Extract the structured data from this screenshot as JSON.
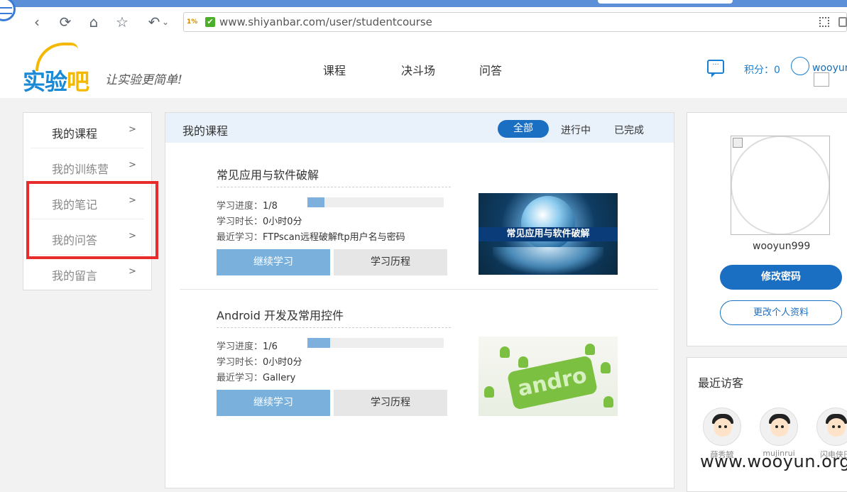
{
  "browser": {
    "url": "www.shiyanbar.com/user/studentcourse",
    "back_label": "‹",
    "refresh_label": "⟳",
    "home_label": "⌂",
    "star_label": "☆",
    "undo_label": "↶",
    "undo_menu_label": "⌄",
    "site_badge": "1%",
    "secure_check": "✔"
  },
  "header": {
    "logo_main": "实验",
    "logo_accent": "吧",
    "slogan": "让实验更简单!",
    "nav": [
      "课程",
      "决斗场",
      "问答"
    ],
    "points_label": "积分：0",
    "username": "wooyun",
    "msg_icon_glyph": "···"
  },
  "sidebar": {
    "items": [
      {
        "label": "我的课程",
        "arrow": ">"
      },
      {
        "label": "我的训练营",
        "arrow": ">"
      },
      {
        "label": "我的笔记",
        "arrow": ">"
      },
      {
        "label": "我的问答",
        "arrow": ">"
      },
      {
        "label": "我的留言",
        "arrow": ">"
      }
    ]
  },
  "main": {
    "title": "我的课程",
    "filters": [
      "全部",
      "进行中",
      "已完成"
    ],
    "labels": {
      "progress": "学习进度：",
      "duration": "学习时长：",
      "recent": "最近学习：",
      "continue": "继续学习",
      "history": "学习历程"
    },
    "courses": [
      {
        "title": "常见应用与软件破解",
        "progress": "1/8",
        "progress_fraction": 0.125,
        "duration": "0小时0分",
        "recent": "FTPscan远程破解ftp用户名与密码",
        "thumb_text": "常见应用与软件破解"
      },
      {
        "title": "Android 开发及常用控件",
        "progress": "1/6",
        "progress_fraction": 0.167,
        "duration": "0小时0分",
        "recent": "Gallery",
        "thumb_text": "andro"
      }
    ]
  },
  "profile": {
    "name": "wooyun999",
    "change_password": "修改密码",
    "edit_profile": "更改个人资料"
  },
  "visitors": {
    "title": "最近访客",
    "list": [
      "薛秀毓",
      "mujinrui",
      "闪电侠巴"
    ]
  },
  "watermark": "www.wooyun.org",
  "colors": {
    "brand_blue": "#1a6fc2",
    "highlight_red": "#e82b2b",
    "progress_fill": "#7db0dc"
  }
}
